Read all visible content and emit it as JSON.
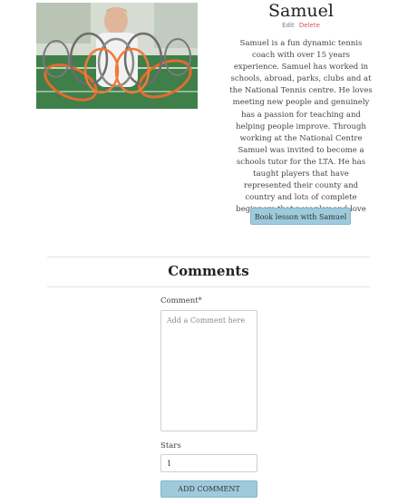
{
  "coach": {
    "name": "Samuel",
    "photo_icon": "coach-photo-with-tennis-rackets",
    "bio": "Samuel is a fun dynamic tennis coach with over 15 years experience. Samuel has worked in schools, abroad, parks, clubs and at the National Tennis centre. He loves meeting new people and genuinely has a passion for teaching and helping people improve. Through working at the National Centre Samuel was invited to become a schools tutor for the LTA. He has taught players that have represented their county and country and lots of complete beginners that now play and love the great game!"
  },
  "admin": {
    "edit_label": "Edit",
    "delete_label": "Delete"
  },
  "booking": {
    "button_label": "Book lesson with Samuel"
  },
  "comments": {
    "heading": "Comments",
    "comment_label": "Comment*",
    "comment_placeholder": "Add a Comment here",
    "stars_label": "Stars",
    "stars_value": "1",
    "submit_label": "ADD COMMENT"
  },
  "colors": {
    "button_bg": "#9ecbdb",
    "delete_link": "#d9534f",
    "divider": "#e4e4e4"
  }
}
